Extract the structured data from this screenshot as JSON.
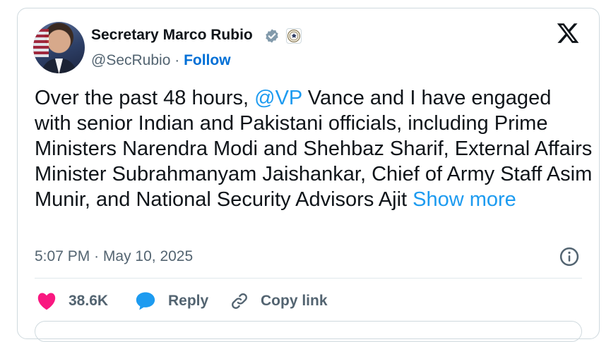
{
  "author": {
    "name": "Secretary Marco Rubio",
    "handle": "@SecRubio",
    "separator": "·",
    "follow_label": "Follow"
  },
  "tweet": {
    "text_before_mention": "Over the past 48 hours, ",
    "mention": "@VP",
    "text_after_mention": " Vance and I have engaged with senior Indian and Pakistani officials, including Prime Ministers Narendra Modi and Shehbaz Sharif, External Affairs Minister Subrahmanyam Jaishankar, Chief of Army Staff Asim Munir, and National Security Advisors Ajit ",
    "show_more_label": "Show more"
  },
  "meta": {
    "time": "5:07 PM",
    "separator": "·",
    "date": "May 10, 2025"
  },
  "actions": {
    "likes_count": "38.6K",
    "reply_label": "Reply",
    "copy_link_label": "Copy link"
  },
  "colors": {
    "link": "#1d9bf0",
    "follow": "#006fd6",
    "heart": "#f91880",
    "reply_bubble": "#1d9bf0",
    "verified_badge": "#829aab"
  },
  "icons": {
    "logo": "x-logo-icon",
    "verified": "verified-badge-icon",
    "affiliation": "state-department-seal-icon",
    "info": "info-icon",
    "like": "heart-icon",
    "reply": "reply-bubble-icon",
    "copy": "link-icon"
  }
}
